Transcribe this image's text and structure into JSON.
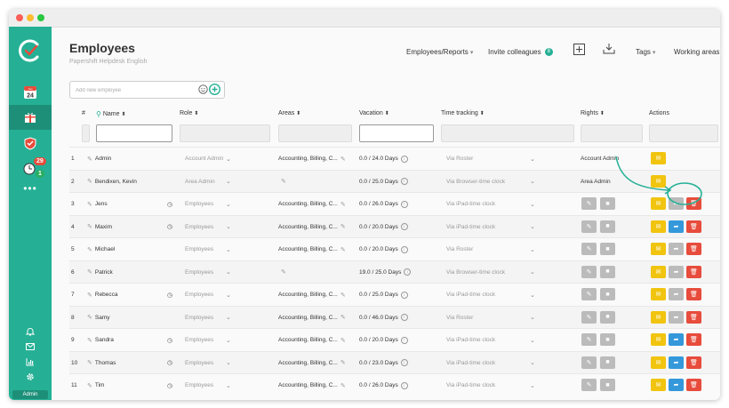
{
  "sidebar": {
    "calendar_month": "Jan",
    "calendar_day": "24",
    "timesheet_badge_top": "29",
    "timesheet_badge_bottom": "1",
    "user_label": "Admin"
  },
  "header": {
    "title": "Employees",
    "subtitle": "Papershift Helpdesk English"
  },
  "topnav": {
    "reports": "Employees/Reports",
    "invite": "Invite colleagues",
    "invite_count": "8",
    "tags": "Tags",
    "working_areas": "Working areas"
  },
  "add_employee": {
    "placeholder": "Add new employee"
  },
  "columns": {
    "num": "#",
    "name": "Name",
    "role": "Role",
    "areas": "Areas",
    "vacation": "Vacation",
    "time_tracking": "Time tracking",
    "rights": "Rights",
    "actions": "Actions"
  },
  "rows": [
    {
      "num": "1",
      "name": "Admin",
      "role": "Account Admin",
      "areas": "Accounting, Billing, C...",
      "vacation": "0.0 / 24.0 Days",
      "tracking": "Via Roster",
      "rights": "Account Admin"
    },
    {
      "num": "2",
      "name": "Bendixen, Kevin",
      "role": "Area Admin",
      "areas": "",
      "vacation": "0.0 / 25.0 Days",
      "tracking": "Via Browser-time clock",
      "rights": "Area Admin"
    },
    {
      "num": "3",
      "name": "Jens",
      "role": "Employees",
      "areas": "Accounting, Billing, C...",
      "vacation": "0.0 / 26.0 Days",
      "tracking": "Via iPad-time clock",
      "rights": ""
    },
    {
      "num": "4",
      "name": "Maxim",
      "role": "Employees",
      "areas": "Accounting, Billing, C...",
      "vacation": "0.0 / 20.0 Days",
      "tracking": "Via iPad-time clock",
      "rights": ""
    },
    {
      "num": "5",
      "name": "Michael",
      "role": "Employees",
      "areas": "Accounting, Billing, C...",
      "vacation": "0.0 / 20.0 Days",
      "tracking": "Via Roster",
      "rights": ""
    },
    {
      "num": "6",
      "name": "Patrick",
      "role": "Employees",
      "areas": "",
      "vacation": "19.0 / 25.0 Days",
      "tracking": "Via Browser-time clock",
      "rights": ""
    },
    {
      "num": "7",
      "name": "Rebecca",
      "role": "Employees",
      "areas": "Accounting, Billing, C...",
      "vacation": "0.0 / 25.0 Days",
      "tracking": "Via iPad-time clock",
      "rights": ""
    },
    {
      "num": "8",
      "name": "Samy",
      "role": "Employees",
      "areas": "Accounting, Billing, C...",
      "vacation": "0.0 / 46.0 Days",
      "tracking": "Via Roster",
      "rights": ""
    },
    {
      "num": "9",
      "name": "Sandra",
      "role": "Employees",
      "areas": "Accounting, Billing, C...",
      "vacation": "0.0 / 20.0 Days",
      "tracking": "Via iPad-time clock",
      "rights": ""
    },
    {
      "num": "10",
      "name": "Thomas",
      "role": "Employees",
      "areas": "Accounting, Billing, C...",
      "vacation": "0.0 / 23.0 Days",
      "tracking": "Via iPad-time clock",
      "rights": ""
    },
    {
      "num": "11",
      "name": "Tim",
      "role": "Employees",
      "areas": "Accounting, Billing, C...",
      "vacation": "0.0 / 26.0 Days",
      "tracking": "Via iPad-time clock",
      "rights": ""
    }
  ],
  "colors": {
    "brand": "#25b095",
    "yellow": "#f1c40f",
    "blue": "#3498db",
    "red": "#e74c3c",
    "gray_button": "#bbbbbb"
  },
  "icons": {
    "mail": "envelope-icon",
    "delete": "trash-icon",
    "share": "share-icon",
    "edit": "edit-icon",
    "lock": "lock-icon"
  }
}
